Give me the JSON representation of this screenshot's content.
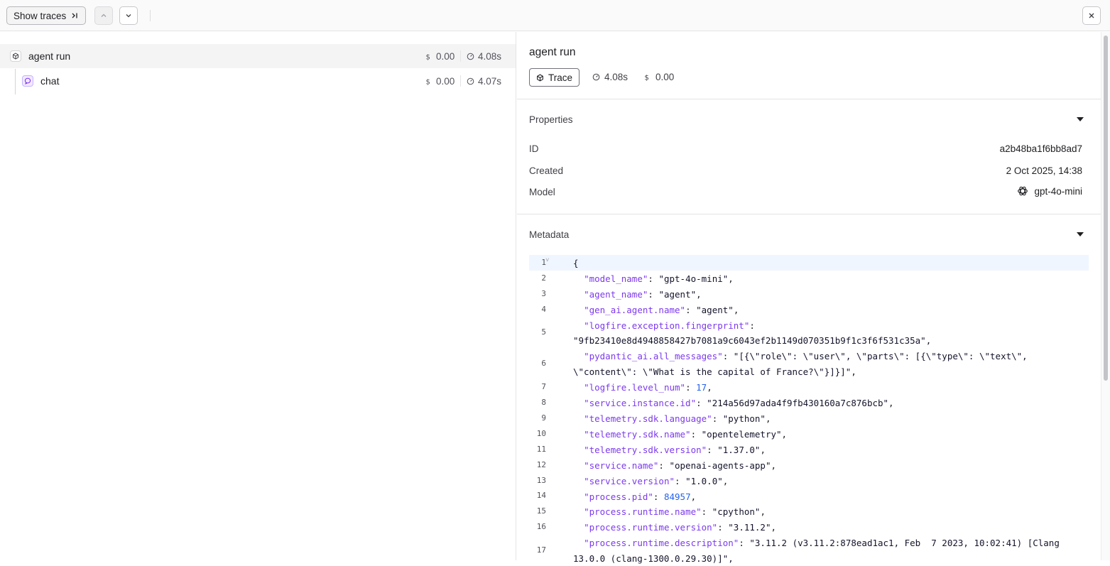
{
  "toolbar": {
    "show_traces_label": "Show traces"
  },
  "tree": {
    "rows": [
      {
        "label": "agent run",
        "cost": "0.00",
        "duration": "4.08s"
      },
      {
        "label": "chat",
        "cost": "0.00",
        "duration": "4.07s"
      }
    ]
  },
  "detail": {
    "title": "agent run",
    "badge_label": "Trace",
    "duration": "4.08s",
    "cost": "0.00",
    "properties": {
      "section_label": "Properties",
      "id_key": "ID",
      "id_value": "a2b48ba1f6bb8ad7",
      "created_key": "Created",
      "created_value": "2 Oct 2025, 14:38",
      "model_key": "Model",
      "model_value": "gpt-4o-mini"
    },
    "metadata": {
      "section_label": "Metadata",
      "lines": [
        {
          "n": "1",
          "open": "{"
        },
        {
          "n": "2",
          "key": "\"model_name\"",
          "val": "\"gpt-4o-mini\"",
          "tail": ","
        },
        {
          "n": "3",
          "key": "\"agent_name\"",
          "val": "\"agent\"",
          "tail": ","
        },
        {
          "n": "4",
          "key": "\"gen_ai.agent.name\"",
          "val": "\"agent\"",
          "tail": ","
        },
        {
          "n": "5",
          "key": "\"logfire.exception.fingerprint\"",
          "val": "",
          "tail": "",
          "cont": "\"9fb23410e8d4948858427b7081a9c6043ef2b1149d070351b9f1c3f6f531c35a\","
        },
        {
          "n": "6",
          "key": "\"pydantic_ai.all_messages\"",
          "val": "\"[{\\\"role\\\": \\\"user\\\", \\\"parts\\\": [{\\\"type\\\": \\\"text\\\",",
          "tail": "",
          "cont": "\\\"content\\\": \\\"What is the capital of France?\\\"}]}]\","
        },
        {
          "n": "7",
          "key": "\"logfire.level_num\"",
          "num": "17",
          "tail": ","
        },
        {
          "n": "8",
          "key": "\"service.instance.id\"",
          "val": "\"214a56d97ada4f9fb430160a7c876bcb\"",
          "tail": ","
        },
        {
          "n": "9",
          "key": "\"telemetry.sdk.language\"",
          "val": "\"python\"",
          "tail": ","
        },
        {
          "n": "10",
          "key": "\"telemetry.sdk.name\"",
          "val": "\"opentelemetry\"",
          "tail": ","
        },
        {
          "n": "11",
          "key": "\"telemetry.sdk.version\"",
          "val": "\"1.37.0\"",
          "tail": ","
        },
        {
          "n": "12",
          "key": "\"service.name\"",
          "val": "\"openai-agents-app\"",
          "tail": ","
        },
        {
          "n": "13",
          "key": "\"service.version\"",
          "val": "\"1.0.0\"",
          "tail": ","
        },
        {
          "n": "14",
          "key": "\"process.pid\"",
          "num": "84957",
          "tail": ","
        },
        {
          "n": "15",
          "key": "\"process.runtime.name\"",
          "val": "\"cpython\"",
          "tail": ","
        },
        {
          "n": "16",
          "key": "\"process.runtime.version\"",
          "val": "\"3.11.2\"",
          "tail": ","
        },
        {
          "n": "17",
          "key": "\"process.runtime.description\"",
          "val": "\"3.11.2 (v3.11.2:878ead1ac1, Feb  7 2023, 10:02:41) [Clang",
          "tail": "",
          "cont": "13.0.0 (clang-1300.0.29.30)]\","
        }
      ]
    }
  }
}
